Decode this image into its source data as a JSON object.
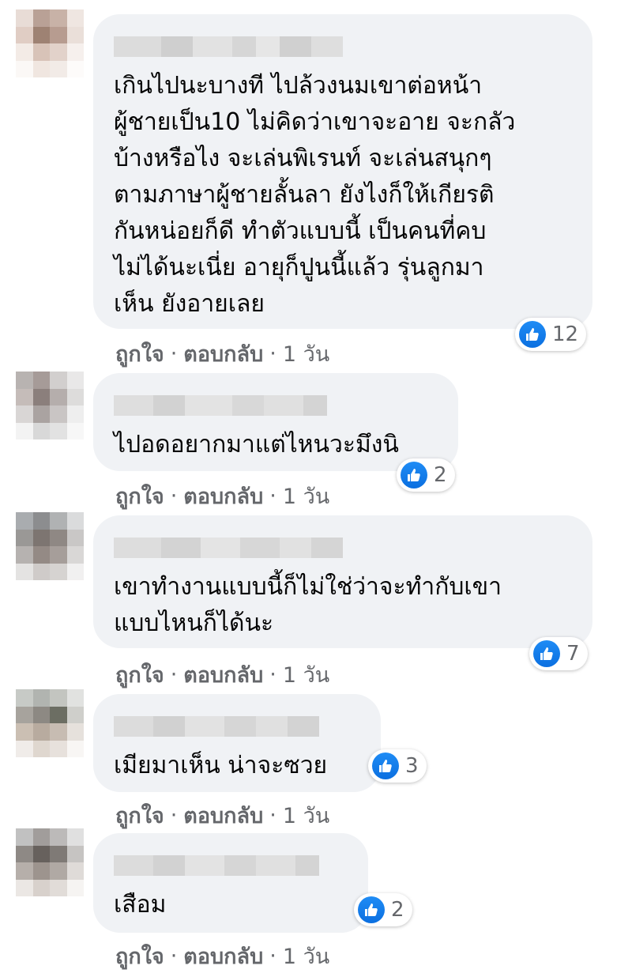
{
  "colors": {
    "bubble": "#f0f2f5",
    "like": "#1877f2",
    "meta": "#65676b"
  },
  "comments": [
    {
      "text": "เกินไปนะบางที ไปล้วงนมเขาต่อหน้า\nผู้ชายเป็น10 ไม่คิดว่าเขาจะอาย จะกลัว\nบ้างหรือไง จะเล่นพิเรนท์ จะเล่นสนุกๆ\nตามภาษาผู้ชายลั้นลา ยังไงก็ให้เกียรติ\nกันหน่อยก็ดี ทำตัวแบบนี้ เป็นคนที่คบ\nไม่ได้นะเนี่ย อายุก็ปูนนี้แล้ว รุ่นลูกมา\nเห็น ยังอายเลย",
      "like_label": "ถูกใจ",
      "reply_label": "ตอบกลับ",
      "time": "1 วัน",
      "reaction_icon": "like-icon",
      "reaction_count": "12"
    },
    {
      "text": "ไปอดอยากมาแต่ไหนวะมึงนิ",
      "like_label": "ถูกใจ",
      "reply_label": "ตอบกลับ",
      "time": "1 วัน",
      "reaction_icon": "like-icon",
      "reaction_count": "2"
    },
    {
      "text": "เขาทำงานแบบนี้ก็ไม่ใช่ว่าจะทำกับเขา\nแบบไหนก็ได้นะ",
      "like_label": "ถูกใจ",
      "reply_label": "ตอบกลับ",
      "time": "1 วัน",
      "reaction_icon": "like-icon",
      "reaction_count": "7"
    },
    {
      "text": "เมียมาเห็น น่าจะซวย",
      "like_label": "ถูกใจ",
      "reply_label": "ตอบกลับ",
      "time": "1 วัน",
      "reaction_icon": "like-icon",
      "reaction_count": "3"
    },
    {
      "text": "เสือม",
      "like_label": "ถูกใจ",
      "reply_label": "ตอบกลับ",
      "time": "1 วัน",
      "reaction_icon": "like-icon",
      "reaction_count": "2"
    }
  ]
}
